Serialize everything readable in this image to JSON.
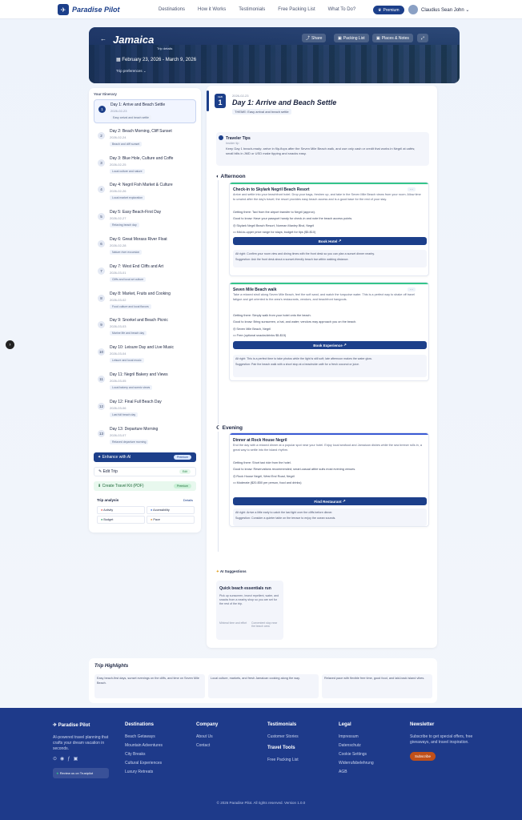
{
  "nav": {
    "brand": "Paradise Pilot",
    "links": [
      "Destinations",
      "How it Works",
      "Testimonials",
      "Free Packing List",
      "What To Do?"
    ],
    "premium": "Premium",
    "user": "Claudius Sean John"
  },
  "hero": {
    "title": "Jamaica",
    "subtitle": "Trip details",
    "dates": "February 23, 2026 - March 9, 2026",
    "prefs": "Trip preferences",
    "share": "Share",
    "packing": "Packing List",
    "places": "Places & Notes"
  },
  "sidebar": {
    "heading": "Your Itinerary",
    "days": [
      {
        "n": "1",
        "title": "Day 1: Arrive and Beach Settle",
        "date": "2026-02-23",
        "tag": "Easy arrival and beach settle"
      },
      {
        "n": "2",
        "title": "Day 2: Beach Morning, Cliff Sunset",
        "date": "2026-02-24",
        "tag": "Beach and cliff sunset"
      },
      {
        "n": "3",
        "title": "Day 3: Blue Hole, Culture and Coffe",
        "date": "2026-02-25",
        "tag": "Local culture and nature"
      },
      {
        "n": "4",
        "title": "Day 4: Negril Fish Market & Culture",
        "date": "2026-02-26",
        "tag": "Local market exploration"
      },
      {
        "n": "5",
        "title": "Day 5: Easy Beach-First Day",
        "date": "2026-02-27",
        "tag": "Relaxing beach day"
      },
      {
        "n": "6",
        "title": "Day 6: Great Morass River Float",
        "date": "2026-02-28",
        "tag": "Nature river excursion"
      },
      {
        "n": "7",
        "title": "Day 7: West End Cliffs and Art",
        "date": "2026-03-01",
        "tag": "Cliffs and local art culture"
      },
      {
        "n": "8",
        "title": "Day 8: Market, Fruits and Cooking",
        "date": "2026-03-02",
        "tag": "Food culture and local flavors"
      },
      {
        "n": "9",
        "title": "Day 9: Snorkel and Beach Picnic",
        "date": "2026-03-03",
        "tag": "Marine life and beach day"
      },
      {
        "n": "10",
        "title": "Day 10: Leisure Day and Live Music",
        "date": "2026-03-04",
        "tag": "Leisure and local music"
      },
      {
        "n": "11",
        "title": "Day 11: Negril Bakery and Views",
        "date": "2026-03-05",
        "tag": "Local bakery and scenic views"
      },
      {
        "n": "12",
        "title": "Day 12: Final Full Beach Day",
        "date": "2026-03-06",
        "tag": "Last full beach day"
      },
      {
        "n": "13",
        "title": "Day 13: Departure Morning",
        "date": "2026-03-07",
        "tag": "Relaxed departure morning"
      }
    ],
    "enhance": "Enhance with AI",
    "enhance_badge": "Premium",
    "edit": "Edit Trip",
    "edit_badge": "Edit",
    "packing": "Create Travel Kit (PDF)",
    "packing_badge": "Premium",
    "analysis_head": "Trip analysis",
    "analysis_link": "Details",
    "analysis": [
      "Activity",
      "Accessibility",
      "Budget",
      "Pace"
    ]
  },
  "day": {
    "month": "FEB",
    "num": "1",
    "date": "2026-02-23",
    "title": "Day 1: Arrive and Beach Settle",
    "theme": "THEME: Easy arrival and beach settle",
    "tips_head": "Traveler Tips",
    "tips_sub": "Insider tip",
    "tips_text": "Keep Day 1 beach-ready: arrive in flip-flops after the Seven Mile Beach walk, and use only cash or credit that works in Negril at cafés; small bills in JMD or USD make tipping and snacks easy.",
    "afternoon": "Afternoon",
    "evening": "Evening",
    "cards": [
      {
        "title": "Check-in to Skylark Negril Beach Resort",
        "desc": "Arrive and settle into your beachfront hotel. Drop your bags, freshen up, and take in the Seven Mile Beach views from your room. Allow time to unwind after the day's travel; the resort provides easy beach access and is a good base for the rest of your stay.",
        "getting": "Getting there: Taxi from the airport transfer to Negril (approx).",
        "good": "Good to know: Have your passport handy for check-in and note the beach access points.",
        "addr": "Skylark Negril Beach Resort, Norman Manley Blvd, Negril",
        "price": "Mid-to-upper price range for stays; budget for tips ($5-$10)",
        "cta": "Book Hotel",
        "alt": "Alt right: Confirm your room view and dining times with the front desk so you can plan a sunset dinner nearby.",
        "suggest": "Suggestion: Ask the front desk about a sunset-friendly beach bar within walking distance."
      },
      {
        "title": "Seven Mile Beach walk",
        "desc": "Take a relaxed stroll along Seven Mile Beach, feel the soft sand, and watch the turquoise water. This is a perfect way to shake off travel fatigue and get oriented to the area's restaurants, vendors, and beachfront hangouts.",
        "getting": "Getting there: Simply walk from your hotel onto the beach.",
        "good": "Good to know: Bring sunscreen, a hat, and water; vendors may approach you on the beach.",
        "addr": "Seven Mile Beach, Negril",
        "price": "Free (optional snacks/drinks $5-$15)",
        "cta": "Book Experience",
        "alt": "Alt right: This is a perfect time to take photos while the light is still soft; late afternoon makes the water glow.",
        "suggest": "Suggestion: Pair the beach walk with a short stop at a beachside café for a fresh coconut or juice."
      },
      {
        "title": "Dinner at Rock House Negril",
        "desc": "End the day with a relaxed dinner at a popular spot near your hotel. Enjoy local seafood and Jamaican dishes while the sea breeze rolls in, a great way to settle into the island rhythm.",
        "getting": "Getting there: Short taxi ride from the hotel.",
        "good": "Good to know: Reservations recommended; smart-casual attire suits most evening venues.",
        "addr": "Rock House Negril, West End Road, Negril",
        "price": "Moderate ($20-$50 per person, food and drinks)",
        "cta": "Find Restaurant",
        "alt": "Alt right: Arrive a little early to catch the last light over the cliffs before dinner.",
        "suggest": "Suggestion: Consider a quieter table on the terrace to enjoy the ocean sounds."
      }
    ],
    "ai_head": "AI Suggestions",
    "ai_title": "Quick beach essentials run",
    "ai_text": "Pick up sunscreen, insect repellent, water, and snacks from a nearby shop so you are set for the rest of the trip.",
    "ai_left": "Minimal time and effort",
    "ai_right": "Convenient stop near the beach area"
  },
  "highlights": {
    "title": "Trip Highlights",
    "items": [
      "Easy beach-first days, sunset evenings on the cliffs, and time on Seven Mile Beach.",
      "Local culture, markets, and fresh Jamaican cooking along the way.",
      "Relaxed pace with flexible free time, good food, and laid-back island vibes."
    ]
  },
  "footer": {
    "brand": "Paradise Pilot",
    "about": "AI-powered travel planning that crafts your dream vacation in seconds.",
    "trustpilot": "Review us on Trustpilot",
    "dest_head": "Destinations",
    "dest": [
      "Beach Getaways",
      "Mountain Adventures",
      "City Breaks",
      "Cultural Experiences",
      "Luxury Retreats"
    ],
    "company_head": "Company",
    "company": [
      "About Us",
      "Contact"
    ],
    "testi_head": "Testimonials",
    "testi": [
      "Customer Stories"
    ],
    "tools_head": "Travel Tools",
    "tools": [
      "Free Packing List"
    ],
    "legal_head": "Legal",
    "legal": [
      "Impressum",
      "Datenschutz",
      "Cookie Settings",
      "Widerrufsbelehrung",
      "AGB"
    ],
    "news_head": "Newsletter",
    "news_text": "Subscribe to get special offers, free giveaways, and travel inspiration.",
    "subscribe": "Subscribe",
    "copyright": "© 2026 Paradise Pilot. All rights reserved. Version 1.0.0"
  }
}
